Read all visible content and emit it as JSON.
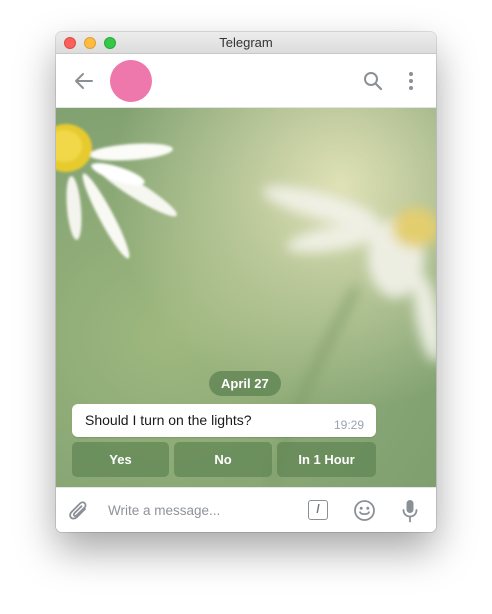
{
  "window": {
    "title": "Telegram"
  },
  "header": {
    "back_icon": "arrow-left-icon",
    "avatar_color": "#ee77ab",
    "search_icon": "search-icon",
    "more_icon": "vertical-dots-icon"
  },
  "chat": {
    "date_label": "April 27",
    "message": {
      "text": "Should I turn on the lights?",
      "time": "19:29"
    },
    "keyboard_buttons": [
      {
        "label": "Yes"
      },
      {
        "label": "No"
      },
      {
        "label": "In 1 Hour"
      }
    ]
  },
  "composer": {
    "attach_icon": "paperclip-icon",
    "placeholder": "Write a message...",
    "command_label": "/",
    "emoji_icon": "smiley-icon",
    "mic_icon": "microphone-icon"
  },
  "colors": {
    "accent_green": "#5c8252",
    "avatar": "#ee77ab"
  }
}
